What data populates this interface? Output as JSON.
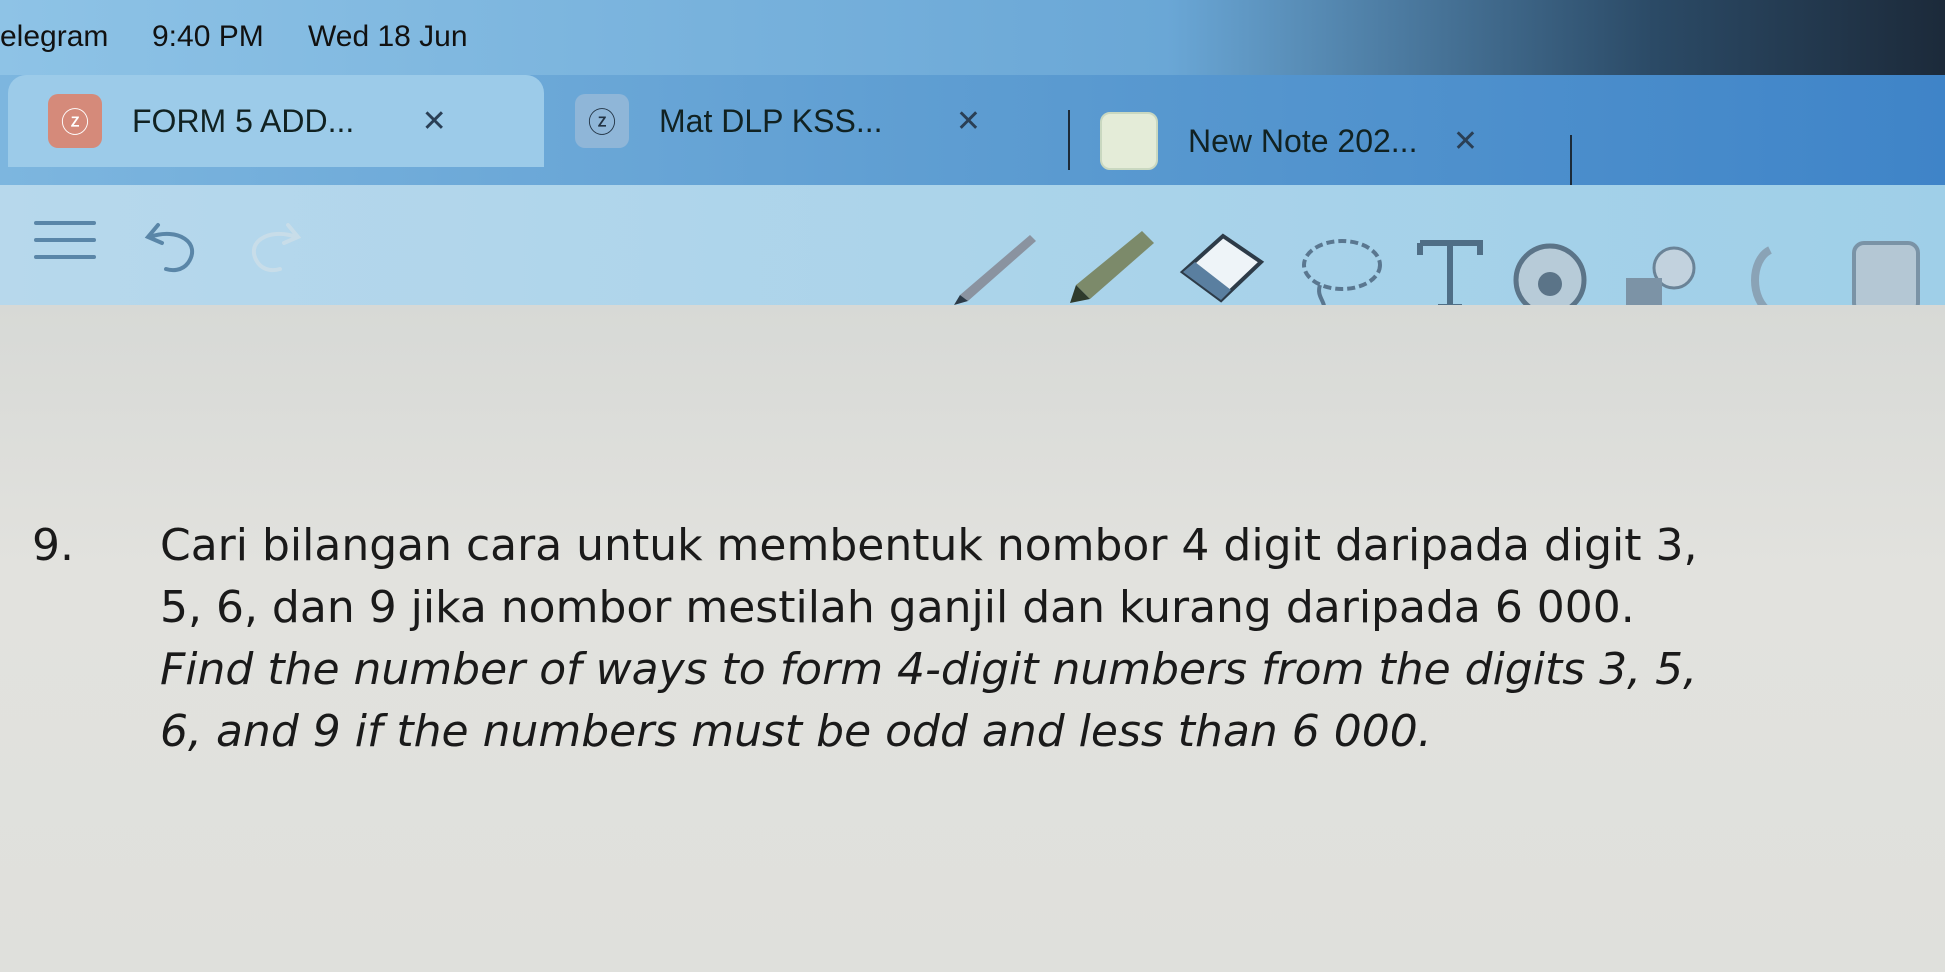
{
  "status_bar": {
    "app": "elegram",
    "time": "9:40 PM",
    "date": "Wed 18 Jun"
  },
  "tabs": [
    {
      "label": "FORM 5 ADD...",
      "icon": "document-app-icon",
      "active": true
    },
    {
      "label": "Mat DLP KSS...",
      "icon": "document-app-icon",
      "active": false
    },
    {
      "label": "New Note 202...",
      "icon": "note-thumbnail-icon",
      "active": false
    }
  ],
  "toolbar": {
    "tools": [
      "menu-icon",
      "undo-icon",
      "redo-icon",
      "pen-icon",
      "highlighter-icon",
      "eraser-icon",
      "lasso-icon",
      "text-icon",
      "sticker-icon",
      "shapes-icon",
      "page-tool-icon",
      "image-icon"
    ]
  },
  "question": {
    "number": "9.",
    "ms_line1": "Cari bilangan cara untuk membentuk nombor 4 digit daripada digit 3,",
    "ms_line2": "5, 6, dan 9 jika nombor mestilah ganjil dan kurang daripada 6 000.",
    "en_line1": "Find the number of ways to form 4-digit numbers from the digits 3, 5,",
    "en_line2": "6, and 9 if the numbers must be odd and less than 6 000."
  },
  "colors": {
    "tab_bar": "#5a9ad0",
    "active_tab": "#9ccbe9",
    "toolbar": "#a9d3ea",
    "page": "#dfe0dc",
    "text": "#1a1a1a"
  }
}
